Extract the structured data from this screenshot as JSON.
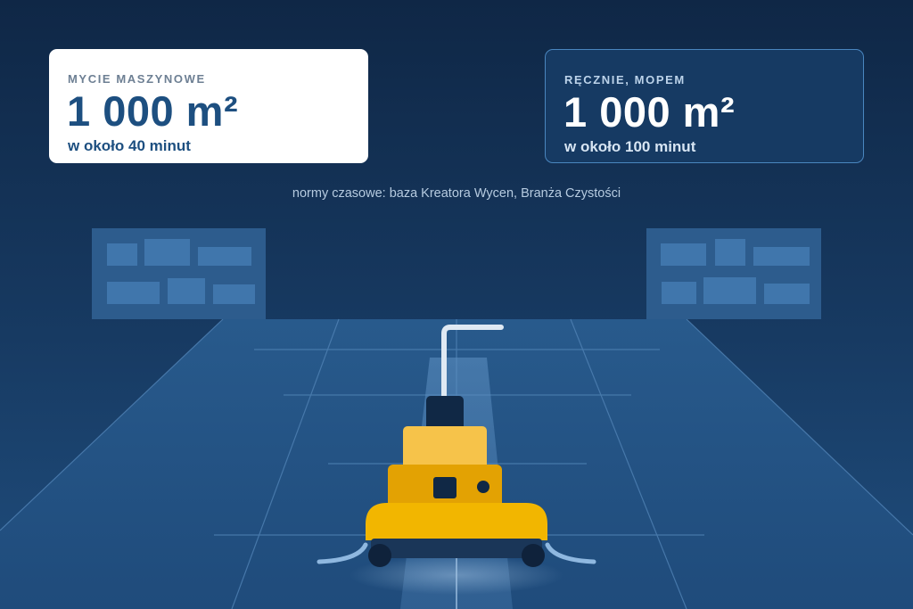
{
  "machine_card": {
    "label": "MYCIE MASZYNOWE",
    "area": "1 000 m²",
    "time": "w około 40 minut"
  },
  "manual_card": {
    "label": "RĘCZNIE, MOPEM",
    "area": "1 000 m²",
    "time": "w około 100 minut"
  },
  "source_note": "normy czasowe: baza Kreatora Wycen, Branża Czystości",
  "colors": {
    "background_top": "#0f2746",
    "background_bottom": "#1f4d7d",
    "accent_yellow": "#f2b600",
    "machine_text": "#1d4f80"
  }
}
